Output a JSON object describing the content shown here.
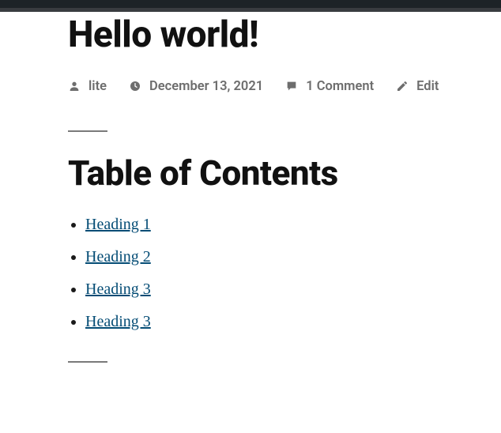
{
  "post": {
    "title": "Hello world!",
    "meta": {
      "author": "lite",
      "date": "December 13, 2021",
      "comments": "1 Comment",
      "edit": "Edit"
    }
  },
  "toc": {
    "heading": "Table of Contents",
    "items": [
      {
        "label": "Heading 1"
      },
      {
        "label": "Heading 2"
      },
      {
        "label": "Heading 3"
      },
      {
        "label": "Heading 3"
      }
    ]
  }
}
